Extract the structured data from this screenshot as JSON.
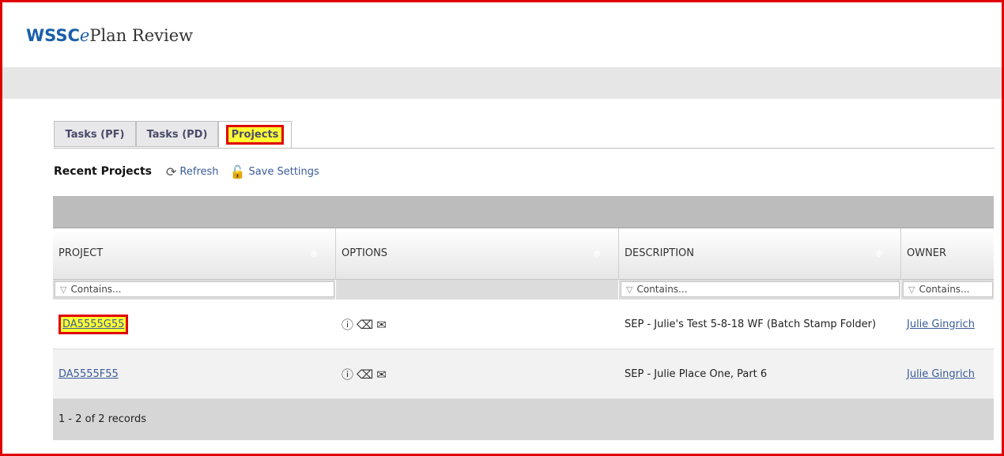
{
  "brand": {
    "part1": "WSSC",
    "part2": "e",
    "part3": "Plan Review"
  },
  "tabs": [
    {
      "label": "Tasks (PF)"
    },
    {
      "label": "Tasks (PD)"
    },
    {
      "label": "Projects"
    }
  ],
  "toolbar": {
    "title": "Recent Projects",
    "refresh_label": "Refresh",
    "save_label": "Save Settings"
  },
  "grid": {
    "columns": [
      "PROJECT",
      "OPTIONS",
      "DESCRIPTION",
      "OWNER"
    ],
    "filter_placeholder": "Contains...",
    "rows": [
      {
        "project": "DA5555G55",
        "description": "SEP - Julie's Test 5-8-18 WF (Batch Stamp Folder)",
        "owner": "Julie Gingrich"
      },
      {
        "project": "DA5555F55",
        "description": "SEP - Julie Place One, Part 6",
        "owner": "Julie Gingrich"
      }
    ],
    "footer": "1 - 2 of 2 records"
  },
  "icons": {
    "info": "info-icon",
    "edit": "eraser-icon",
    "mail": "mail-icon",
    "refresh": "refresh-icon",
    "save": "save-settings-icon",
    "column_menu": "gear-icon",
    "filter": "funnel-icon"
  },
  "colors": {
    "highlight": "#ffff33",
    "annotation_border": "#e00000",
    "link": "#3a5a9a",
    "brand": "#1a5fa8"
  }
}
